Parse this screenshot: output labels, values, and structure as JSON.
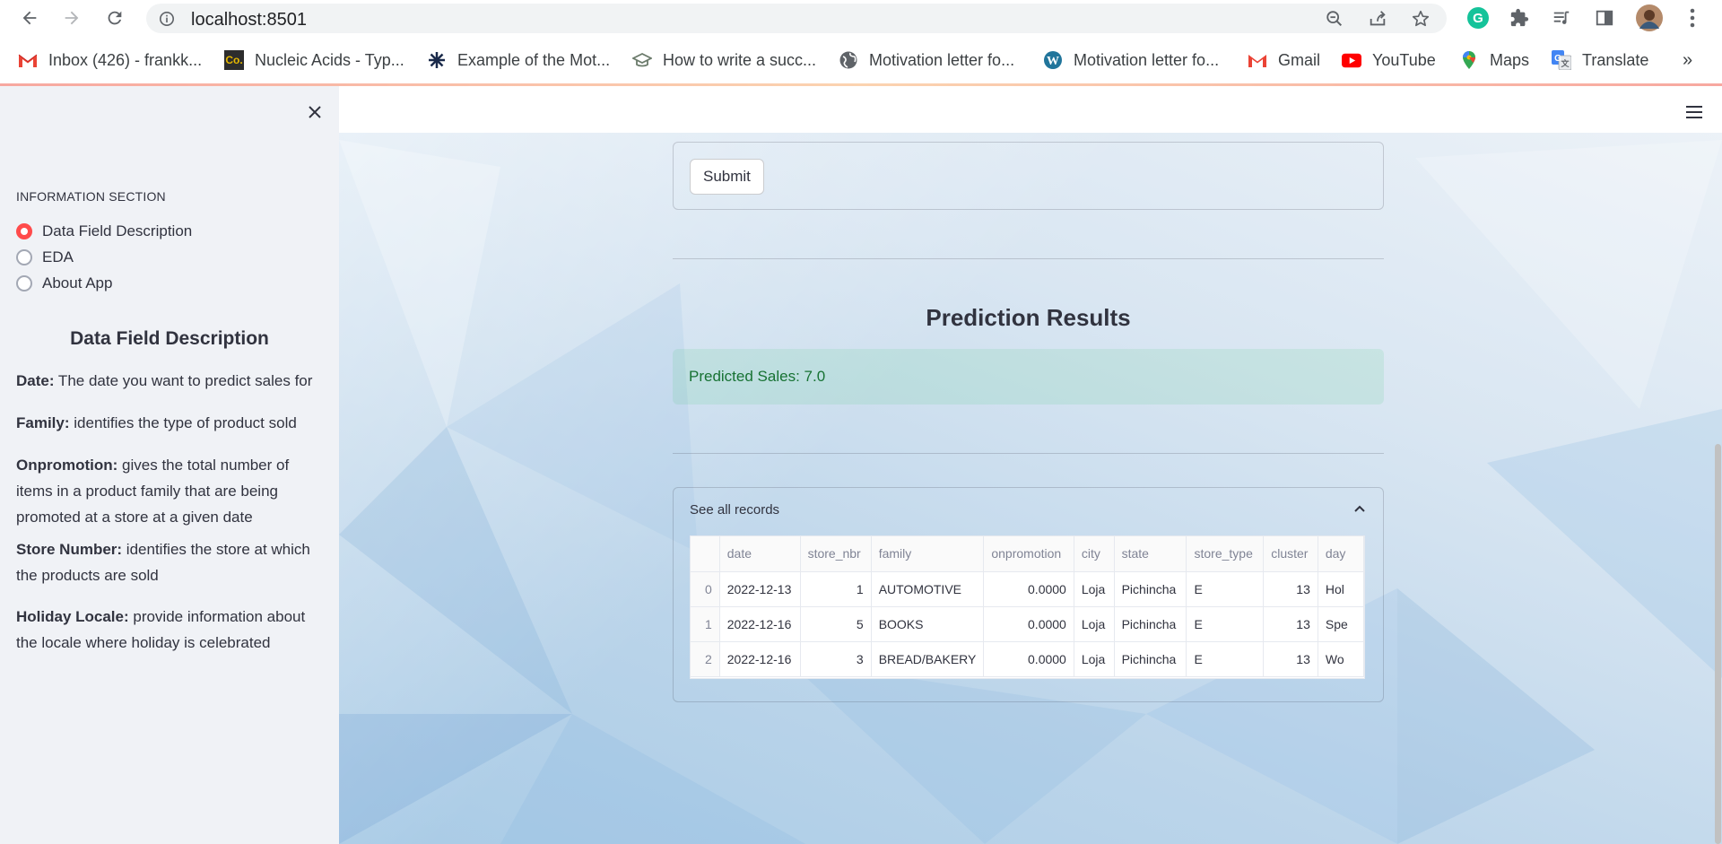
{
  "browser": {
    "url": "localhost:8501",
    "bookmarks": [
      {
        "label": "Inbox (426) - frankk...",
        "icon": "gmail-icon"
      },
      {
        "label": "Nucleic Acids - Typ...",
        "icon": "co-icon"
      },
      {
        "label": "Example of the Mot...",
        "icon": "windmill-icon"
      },
      {
        "label": "How to write a succ...",
        "icon": "graduation-cap-icon"
      },
      {
        "label": "Motivation letter fo...",
        "icon": "globe-icon"
      },
      {
        "label": "Motivation letter fo...",
        "icon": "wordpress-icon"
      },
      {
        "label": "Gmail",
        "icon": "gmail-icon"
      },
      {
        "label": "YouTube",
        "icon": "youtube-icon"
      },
      {
        "label": "Maps",
        "icon": "maps-icon"
      },
      {
        "label": "Translate",
        "icon": "translate-icon"
      }
    ],
    "more_bookmarks": "»"
  },
  "sidebar": {
    "section_label": "INFORMATION SECTION",
    "options": [
      {
        "label": "Data Field Description",
        "selected": true
      },
      {
        "label": "EDA",
        "selected": false
      },
      {
        "label": "About App",
        "selected": false
      }
    ],
    "heading": "Data Field Description",
    "fields": [
      {
        "name": "Date:",
        "desc": " The date you want to predict sales for"
      },
      {
        "name": "Family:",
        "desc": " identifies the type of product sold"
      },
      {
        "name": "Onpromotion:",
        "desc": " gives the total number of items in a product family that are being promoted at a store at a given date"
      },
      {
        "name": "Store Number:",
        "desc": " identifies the store at which the products are sold"
      },
      {
        "name": "Holiday Locale:",
        "desc": " provide information about the locale where holiday is celebrated"
      }
    ]
  },
  "main": {
    "submit_label": "Submit",
    "prediction_title": "Prediction Results",
    "prediction_text": "Predicted Sales: 7.0",
    "expander_title": "See all records",
    "table": {
      "columns": [
        "",
        "date",
        "store_nbr",
        "family",
        "onpromotion",
        "city",
        "state",
        "store_type",
        "cluster",
        "day"
      ],
      "rows": [
        [
          "0",
          "2022-12-13",
          "1",
          "AUTOMOTIVE",
          "0.0000",
          "Loja",
          "Pichincha",
          "E",
          "13",
          "Hol"
        ],
        [
          "1",
          "2022-12-16",
          "5",
          "BOOKS",
          "0.0000",
          "Loja",
          "Pichincha",
          "E",
          "13",
          "Spe"
        ],
        [
          "2",
          "2022-12-16",
          "3",
          "BREAD/BAKERY",
          "0.0000",
          "Loja",
          "Pichincha",
          "E",
          "13",
          "Wo"
        ]
      ]
    }
  },
  "colors": {
    "accent": "#ff4b4b",
    "success_text": "#177233",
    "sidebar_bg": "#f0f2f6"
  }
}
